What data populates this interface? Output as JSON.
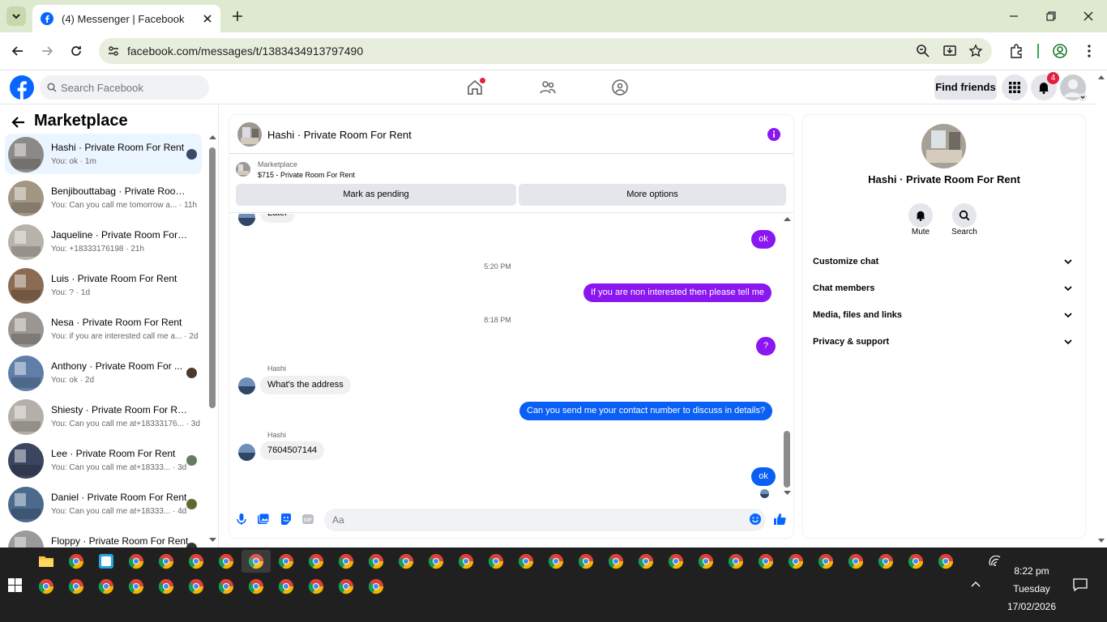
{
  "browser": {
    "tab_title": "(4) Messenger | Facebook",
    "url": "facebook.com/messages/t/1383434913797490"
  },
  "fb_header": {
    "search_placeholder": "Search Facebook",
    "find_friends": "Find friends",
    "notif_count": "4"
  },
  "left": {
    "title": "Marketplace",
    "conversations": [
      {
        "name": "Hashi · Private Room For Rent",
        "preview": "You: ok · 1m",
        "active": true,
        "av": "#8c8a86"
      },
      {
        "name": "Benjibouttabag · Private Room ...",
        "preview": "You: Can you call me tomorrow a... · 11h",
        "av": "#a39784"
      },
      {
        "name": "Jaqueline · Private Room For Re...",
        "preview": "You: +18333176198 · 21h",
        "av": "#b7b2aa"
      },
      {
        "name": "Luis · Private Room For Rent",
        "preview": "You: ? · 1d",
        "av": "#8b6c52"
      },
      {
        "name": "Nesa · Private Room For Rent",
        "preview": "You: if you are interested call me a... · 2d",
        "av": "#9a9792"
      },
      {
        "name": "Anthony · Private Room For ...",
        "preview": "You: ok · 2d",
        "av": "#5f7fa8"
      },
      {
        "name": "Shiesty · Private Room For Rent",
        "preview": "You: Can you call me at+18333176... · 3d",
        "av": "#b4b0a9"
      },
      {
        "name": "Lee · Private Room For Rent",
        "preview": "You: Can you call me at+18333... · 3d",
        "av": "#3c4560"
      },
      {
        "name": "Daniel · Private Room For Rent",
        "preview": "You: Can you call me at+18333... · 4d",
        "av": "#4a6a8e"
      },
      {
        "name": "Floppy · Private Room For Rent",
        "preview": "",
        "av": "#9a9a9a"
      }
    ]
  },
  "chat": {
    "title": "Hashi · Private Room For Rent",
    "marketplace_label": "Marketplace",
    "listing": "$715 - Private Room For Rent",
    "mark_pending": "Mark as pending",
    "more_options": "More options",
    "partial_msg": "Later",
    "msg_ok1": "ok",
    "time1": "5:20 PM",
    "msg_notinterested": "If you are non interested then please tell me",
    "time2": "8:18 PM",
    "msg_q": "?",
    "sender1": "Hashi",
    "msg_address": "What's the address",
    "msg_contact": "Can you send me your contact number to discuss in details?",
    "sender2": "Hashi",
    "msg_number": "7604507144",
    "msg_ok2": "ok",
    "composer_placeholder": "Aa"
  },
  "right": {
    "name": "Hashi · Private Room For Rent",
    "mute": "Mute",
    "search": "Search",
    "rows": [
      "Customize chat",
      "Chat members",
      "Media, files and links",
      "Privacy & support"
    ]
  },
  "taskbar": {
    "time": "8:22 pm",
    "day": "Tuesday",
    "date": "17/02/2026"
  },
  "colors": {
    "fb_blue": "#0866ff",
    "my_bubble_purple": "#8a16f0",
    "my_bubble_blue": "#0a60f5"
  }
}
